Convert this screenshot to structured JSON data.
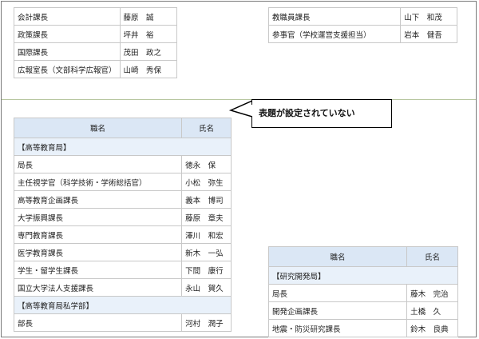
{
  "top_left_rows": [
    {
      "title": "会計課長",
      "name": "藤原　誠"
    },
    {
      "title": "政策課長",
      "name": "坪井　裕"
    },
    {
      "title": "国際課長",
      "name": "茂田　政之"
    },
    {
      "title": "広報室長（文部科学広報官）",
      "name": "山崎　秀保"
    }
  ],
  "top_right_rows": [
    {
      "title": "教職員課長",
      "name": "山下　和茂"
    },
    {
      "title": "参事官（学校運営支援担当）",
      "name": "岩本　健吾"
    }
  ],
  "callout_text": "表題が設定されていない",
  "headers": {
    "title": "職名",
    "name": "氏名"
  },
  "left_table": [
    {
      "section": "【高等教育局】"
    },
    {
      "title": "局長",
      "name": "徳永　保"
    },
    {
      "title": "主任視学官（科学技術・学術総括官）",
      "name": "小松　弥生"
    },
    {
      "title": "高等教育企画課長",
      "name": "義本　博司"
    },
    {
      "title": "大学振興課長",
      "name": "藤原　章夫"
    },
    {
      "title": "専門教育課長",
      "name": "澤川　和宏"
    },
    {
      "title": "医学教育課長",
      "name": "新木　一弘"
    },
    {
      "title": "学生・留学生課長",
      "name": "下間　康行"
    },
    {
      "title": "国立大学法人支援課長",
      "name": "永山　賀久"
    },
    {
      "section": "【高等教育局私学部】"
    },
    {
      "title": "部長",
      "name": "河村　潤子"
    }
  ],
  "right_table": [
    {
      "section": "【研究開発局】"
    },
    {
      "title": "局長",
      "name": "藤木　完治"
    },
    {
      "title": "開発企画課長",
      "name": "土橋　久"
    },
    {
      "title": "地震・防災研究課長",
      "name": "鈴木　良典"
    }
  ]
}
